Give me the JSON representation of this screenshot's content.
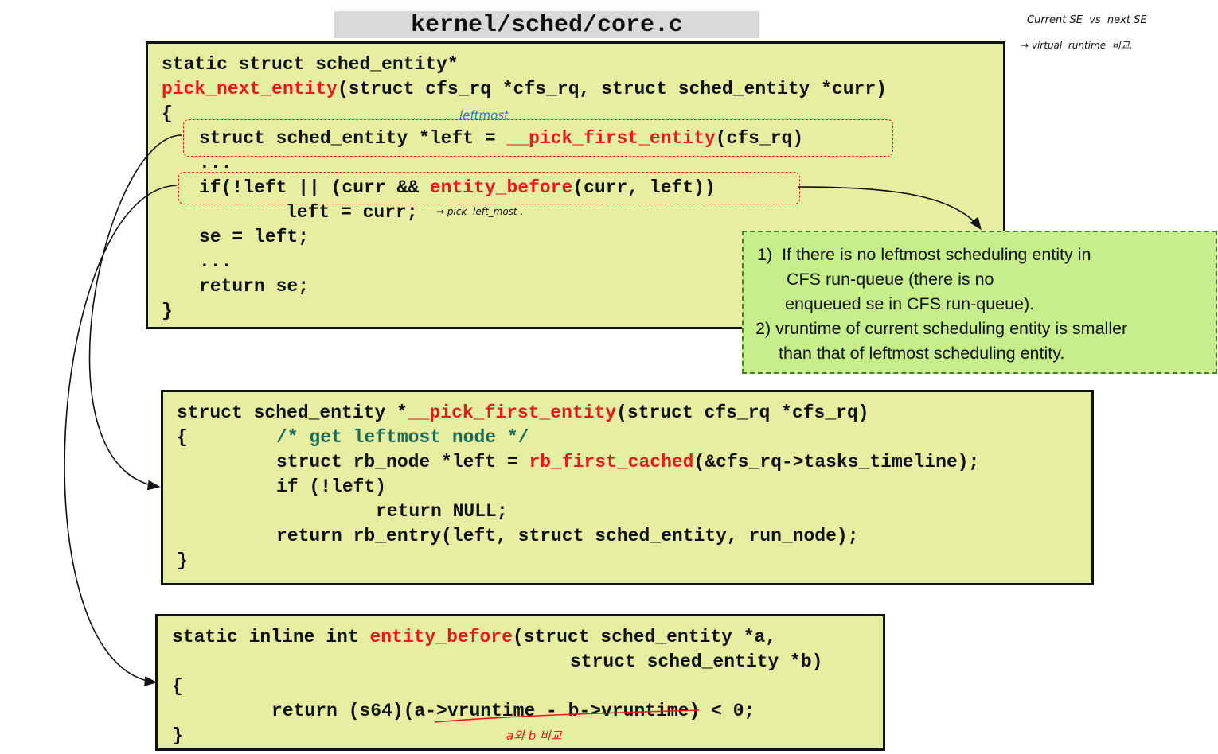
{
  "title": "kernel/sched/core.c",
  "box1": {
    "l1": "static struct sched_entity*",
    "l2_fn": "pick_next_entity",
    "l2_rest": "(struct cfs_rq *cfs_rq, struct sched_entity *curr)",
    "l3": "{",
    "l4_pre": "struct sched_entity *left = ",
    "l4_fn": "__pick_first_entity",
    "l4_post": "(cfs_rq)",
    "l5": "...",
    "l6_pre": "if(!left || (curr && ",
    "l6_fn": "entity_before",
    "l6_post": "(curr, left))",
    "l7": "left = curr;",
    "l8": "se = left;",
    "l9": "...",
    "l10": "return se;",
    "l11": "}"
  },
  "box2": {
    "l1_pre": "struct sched_entity *",
    "l1_fn": "__pick_first_entity",
    "l1_post": "(struct cfs_rq *cfs_rq)",
    "l2_brace": "{",
    "l2_comment": "/* get leftmost node */",
    "l3_pre": "struct rb_node *left = ",
    "l3_fn": "rb_first_cached",
    "l3_post": "(&cfs_rq->tasks_timeline);",
    "l4": "if (!left)",
    "l5": "return NULL;",
    "l6": "return rb_entry(left, struct sched_entity, run_node);",
    "l7": "}"
  },
  "box3": {
    "l1_pre": "static inline int ",
    "l1_fn": "entity_before",
    "l1_post": "(struct sched_entity *a,",
    "l2": "struct sched_entity *b)",
    "l3": "{",
    "l4": "return (s64)(a->vruntime - b->vruntime) < 0;",
    "l5": "}"
  },
  "note": {
    "l1": "1)  If there is no leftmost scheduling entity in",
    "l2": "CFS run-queue (there is no",
    "l3": "enqueued se in CFS run-queue).",
    "l4": "2) vruntime of current scheduling entity is smaller",
    "l5": "than that of leftmost scheduling entity."
  },
  "handwriting": {
    "top_right_1": "Current SE  vs  next SE",
    "top_right_2": "→ virtual  runtime  비교.",
    "leftmost": "leftmost",
    "pick": "→ pick  left_most .",
    "compare": "a와 b 비교"
  },
  "colors": {
    "code_bg": "#e6eea2",
    "function_red": "#e5191e",
    "comment_teal": "#1a6b5a",
    "note_bg": "#c6ef8c",
    "handwriting_blue": "#2f6fd6"
  }
}
